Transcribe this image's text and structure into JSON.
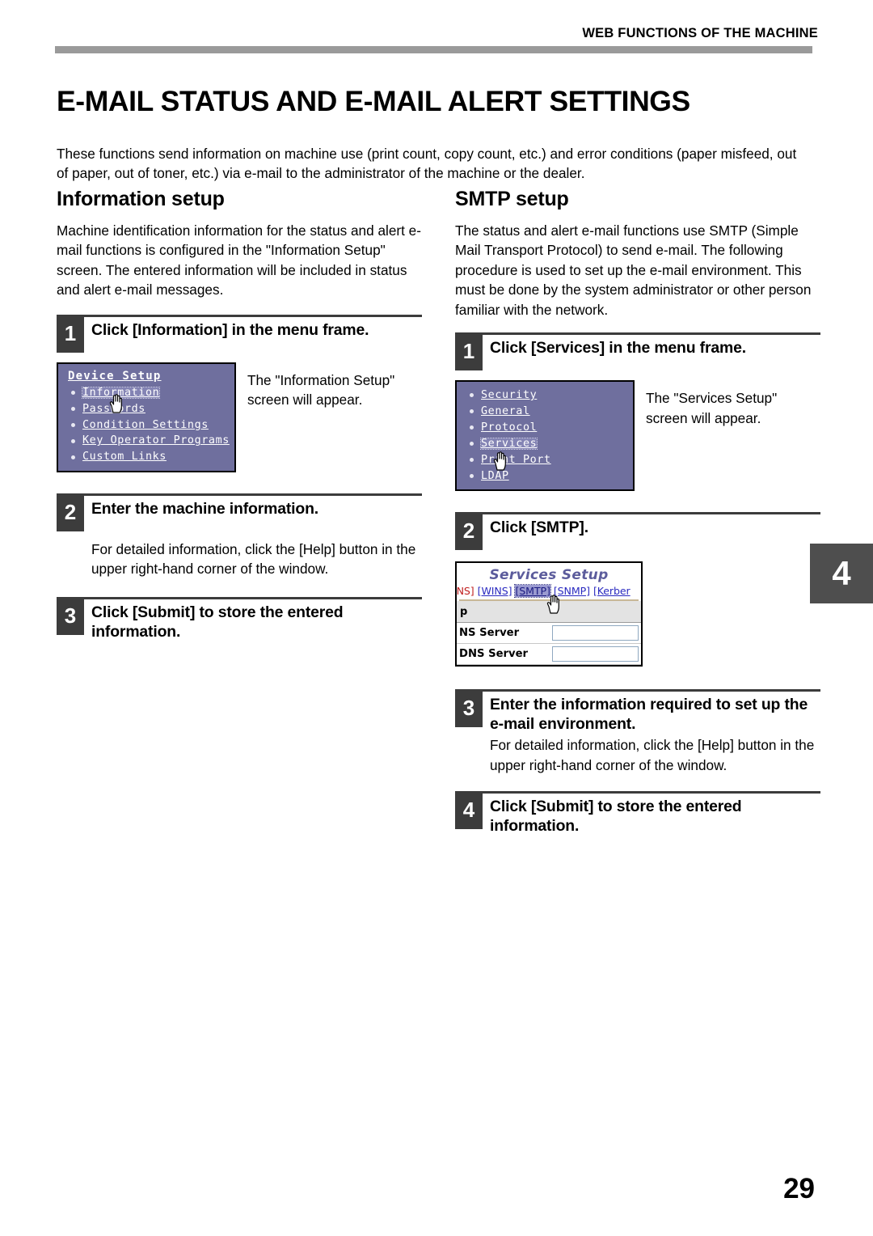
{
  "header": {
    "running_title": "WEB FUNCTIONS OF THE MACHINE",
    "chapter_tab": "4",
    "page_number": "29"
  },
  "title": "E-MAIL STATUS AND E-MAIL ALERT SETTINGS",
  "intro": "These functions send information on machine use (print count, copy count, etc.) and error conditions (paper misfeed, out of paper, out of toner, etc.) via e-mail to the administrator of the machine or the dealer.",
  "left_column": {
    "section_title": "Information setup",
    "section_desc": "Machine identification information for the status and alert e-mail functions is configured in the \"Information Setup\" screen. The entered information will be included in status and alert e-mail messages.",
    "steps": [
      {
        "number": "1",
        "title": "Click [Information] in the menu frame.",
        "caption": "The \"Information Setup\" screen will appear."
      },
      {
        "number": "2",
        "title": "Enter the machine information.",
        "body": "For detailed information, click the [Help] button in the upper right-hand corner of the window."
      },
      {
        "number": "3",
        "title": "Click [Submit] to store the entered information."
      }
    ],
    "device_menu": {
      "heading": "Device Setup",
      "items": [
        {
          "label": "Information",
          "selected": true
        },
        {
          "label": "Passwords",
          "selected": false
        },
        {
          "label": "Condition Settings",
          "selected": false
        },
        {
          "label": "Key Operator Programs",
          "selected": false
        },
        {
          "label": "Custom Links",
          "selected": false
        }
      ]
    }
  },
  "right_column": {
    "section_title": "SMTP setup",
    "section_desc": "The status and alert e-mail functions use SMTP (Simple Mail Transport Protocol) to send e-mail. The following procedure is used to set up the e-mail environment. This must be done by the system administrator or other person familiar with the network.",
    "steps": [
      {
        "number": "1",
        "title": "Click [Services] in the menu frame.",
        "caption": "The \"Services Setup\" screen will appear."
      },
      {
        "number": "2",
        "title": "Click [SMTP]."
      },
      {
        "number": "3",
        "title": "Enter the information required to set up the e-mail environment.",
        "body": "For detailed information, click the [Help] button in the upper right-hand corner of the window."
      },
      {
        "number": "4",
        "title": "Click [Submit] to store the entered information."
      }
    ],
    "network_menu": {
      "items": [
        {
          "label": "Security",
          "selected": false
        },
        {
          "label": "General",
          "selected": false
        },
        {
          "label": "Protocol",
          "selected": false
        },
        {
          "label": "Services",
          "selected": true
        },
        {
          "label": "Print Port",
          "selected": false
        },
        {
          "label": "LDAP",
          "selected": false
        }
      ]
    },
    "services_window": {
      "title": "Services Setup",
      "tabs": [
        {
          "label": "DNS]",
          "selected": false,
          "style": "first"
        },
        {
          "label": "[WINS]",
          "selected": false,
          "style": "link"
        },
        {
          "label": "[SMTP]",
          "selected": true,
          "style": "link"
        },
        {
          "label": "[SNMP]",
          "selected": false,
          "style": "link"
        },
        {
          "label": "[Kerber",
          "selected": false,
          "style": "link"
        }
      ],
      "band_label": "p",
      "rows": [
        {
          "label": "NS Server",
          "value": ""
        },
        {
          "label": " DNS Server",
          "value": ""
        }
      ]
    }
  },
  "colors": {
    "menu_background": "#6f6f9e",
    "step_marker": "#3c3c3c",
    "header_rule": "#9a9a9a",
    "chapter_tab": "#4e4e4e",
    "services_title": "#5c5c9c",
    "link_blue": "#2a2ac0"
  }
}
